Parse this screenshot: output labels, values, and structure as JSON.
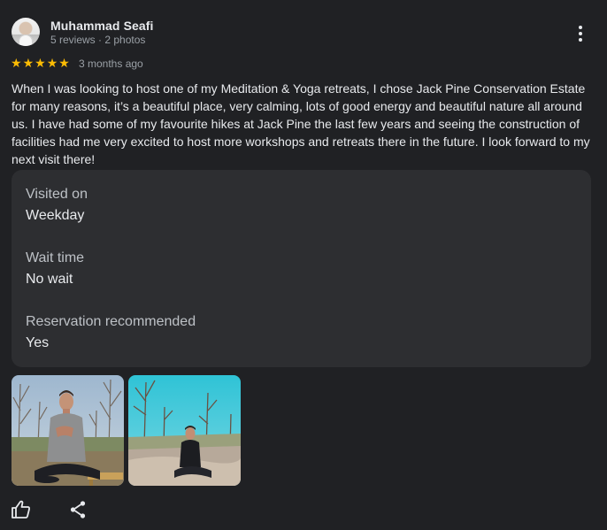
{
  "author": {
    "name": "Muhammad Seafi",
    "meta": "5 reviews · 2 photos"
  },
  "rating": {
    "stars": 5,
    "star_glyph": "★",
    "star_color": "#fbbc04",
    "time_ago": "3 months ago"
  },
  "review_text": "When I was looking to host one of my Meditation & Yoga retreats, I chose Jack Pine Conservation Estate for many reasons, it’s a beautiful place, very calming, lots of good energy and beautiful nature all around us. I have had some of my favourite hikes at Jack Pine the last few years and seeing the construction of facilities had me very excited to host more workshops and retreats there in the future. I look forward to my next visit there!",
  "details": [
    {
      "label": "Visited on",
      "value": "Weekday"
    },
    {
      "label": "Wait time",
      "value": "No wait"
    },
    {
      "label": "Reservation recommended",
      "value": "Yes"
    }
  ],
  "photos": [
    {
      "name": "meditation-photo-deck"
    },
    {
      "name": "meditation-photo-rock"
    }
  ],
  "actions": {
    "like_icon": "thumb-up-icon",
    "share_icon": "share-icon",
    "more_icon": "more-vert-icon"
  }
}
